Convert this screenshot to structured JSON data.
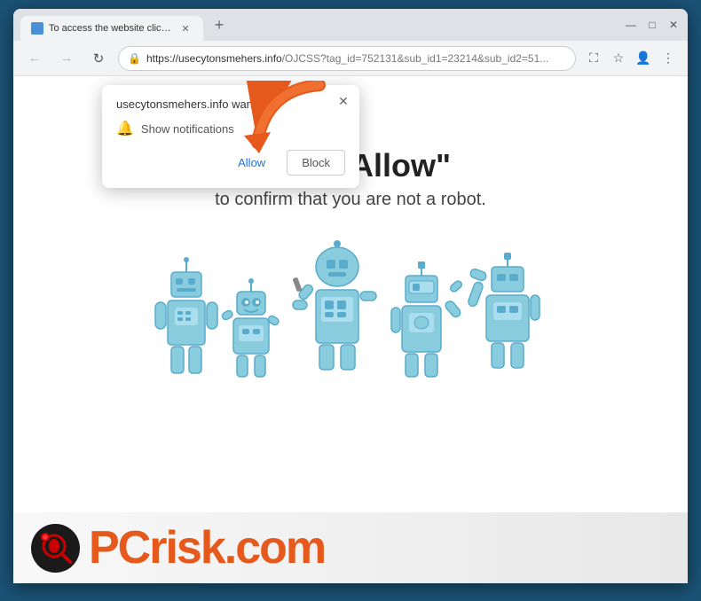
{
  "browser": {
    "tab_title": "To access the website click the \"",
    "tab_favicon_color": "#4a90d9",
    "url": "https://usecytonsmehers.info/OJCSS?tag_id=752131&sub_id1=23214&sub_id2=51...",
    "url_domain": "https://usecytonsmehers.info",
    "url_path": "/OJCSS?tag_id=752131&sub_id1=23214&sub_id2=51..."
  },
  "nav": {
    "back_label": "‹",
    "forward_label": "›",
    "refresh_label": "↻",
    "new_tab_label": "+"
  },
  "window_controls": {
    "minimize": "—",
    "maximize": "□",
    "close": "✕"
  },
  "notification_popup": {
    "title": "usecytonsmehers.info wants to",
    "notification_text": "Show notifications",
    "allow_label": "Allow",
    "block_label": "Block",
    "close_label": "✕"
  },
  "page": {
    "heading": "Click \"Allow\"",
    "subheading": "to confirm that you are not a robot."
  },
  "pcrisk": {
    "text_pc": "PC",
    "text_risk": "risk",
    "text_com": ".com"
  }
}
